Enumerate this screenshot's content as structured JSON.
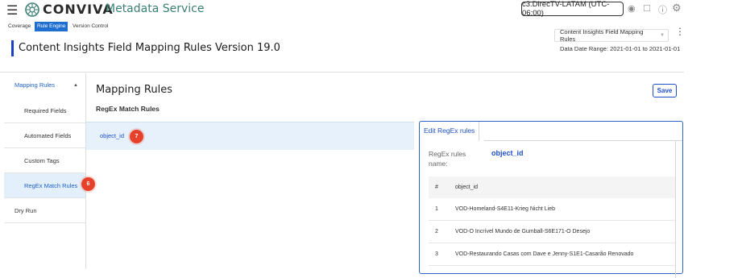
{
  "app": {
    "brand": "CONVIVA",
    "service": "Metadata Service",
    "account": "c3.DirecTV-LATAM (UTC-06:00)"
  },
  "tabs": [
    {
      "label": "Coverage",
      "active": false
    },
    {
      "label": "Rule Engine",
      "active": true
    },
    {
      "label": "Version Control",
      "active": false
    }
  ],
  "header": {
    "title": "Content Insights Field Mapping Rules Version 19.0",
    "config_select": "Content Insights Field Mapping Rules",
    "date_range": "Data Date Range: 2021-01-01 to 2021-01-01"
  },
  "sidebar": {
    "section": "Mapping Rules",
    "items": [
      {
        "label": "Required Fields",
        "active": false
      },
      {
        "label": "Automated Fields",
        "active": false
      },
      {
        "label": "Custom Tags",
        "active": false
      },
      {
        "label": "RegEx Match Rules",
        "active": true
      }
    ],
    "dry_run": "Dry Run",
    "step_badge": "6"
  },
  "main": {
    "title": "Mapping Rules",
    "subtitle": "RegEx Match Rules",
    "save_label": "Save",
    "rule_name": "object_id",
    "step_badge": "7"
  },
  "panel": {
    "tab_label": "Edit RegEx rules",
    "field_label": "RegEx rules name:",
    "field_value": "object_id",
    "columns": [
      "#",
      "object_id"
    ],
    "rows": [
      {
        "n": "1",
        "value": "VOD-Homeland-S4E11-Krieg Nicht Lieb"
      },
      {
        "n": "2",
        "value": "VOD-O Incrível Mundo de Gumball-S6E171-O Desejo"
      },
      {
        "n": "3",
        "value": "VOD-Restaurando Casas com Dave e Jenny-S1E1-Casarão Renovado"
      }
    ]
  },
  "colors": {
    "accent": "#1f4fc9",
    "active_tab": "#1f6fd1",
    "step_badge": "#e8412b",
    "brand_text": "#3a7f74"
  }
}
